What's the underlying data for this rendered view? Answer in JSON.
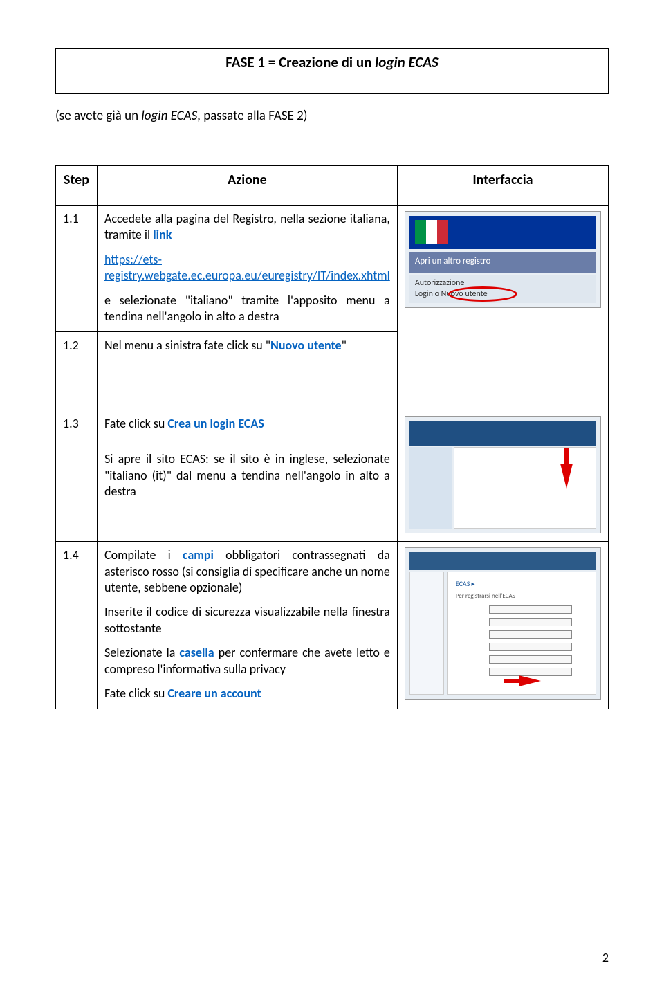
{
  "title_box": {
    "prefix": "FASE 1 = Creazione di un ",
    "italic": "login ECAS"
  },
  "intro": {
    "prefix": "(se avete già un ",
    "italic": "login ECAS",
    "suffix": ", passate alla FASE 2)"
  },
  "headers": {
    "step": "Step",
    "action": "Azione",
    "interface": "Interfaccia"
  },
  "steps": {
    "s1": {
      "num": "1.1",
      "line1_a": "Accedete alla pagina del Registro, nella sezione italiana, tramite il ",
      "line1_link_word": "link",
      "url": "https://ets-registry.webgate.ec.europa.eu/euregistry/IT/index.xhtml",
      "line3": "e selezionate \"italiano\" tramite l'apposito menu a tendina nell'angolo in alto a destra"
    },
    "s2": {
      "num": "1.2",
      "line_a": "Nel menu a sinistra fate click su \"",
      "link": "Nuovo utente",
      "line_b": "\""
    },
    "s3": {
      "num": "1.3",
      "line1_a": "Fate click su ",
      "line1_link": "Crea un login ECAS",
      "para": "Si apre il sito ECAS: se il sito è in inglese, selezionate \"italiano (it)\" dal menu a tendina nell'angolo in alto a destra"
    },
    "s4": {
      "num": "1.4",
      "p1_a": "Compilate i ",
      "p1_link": "campi",
      "p1_b": " obbligatori contrassegnati da asterisco rosso (si consiglia di specificare anche un nome utente, sebbene opzionale)",
      "p2": "Inserite il codice di sicurezza visualizzabile nella finestra sottostante",
      "p3_a": "Selezionate la ",
      "p3_link": "casella",
      "p3_b": " per confermare che avete letto e compreso l'informativa sulla privacy",
      "p4_a": "Fate click su ",
      "p4_link": "Creare un account"
    }
  },
  "shot1": {
    "mid": "Apri un altro registro",
    "auth": "Autorizzazione",
    "login": "Login o Nuovo utente"
  },
  "page_number": "2"
}
